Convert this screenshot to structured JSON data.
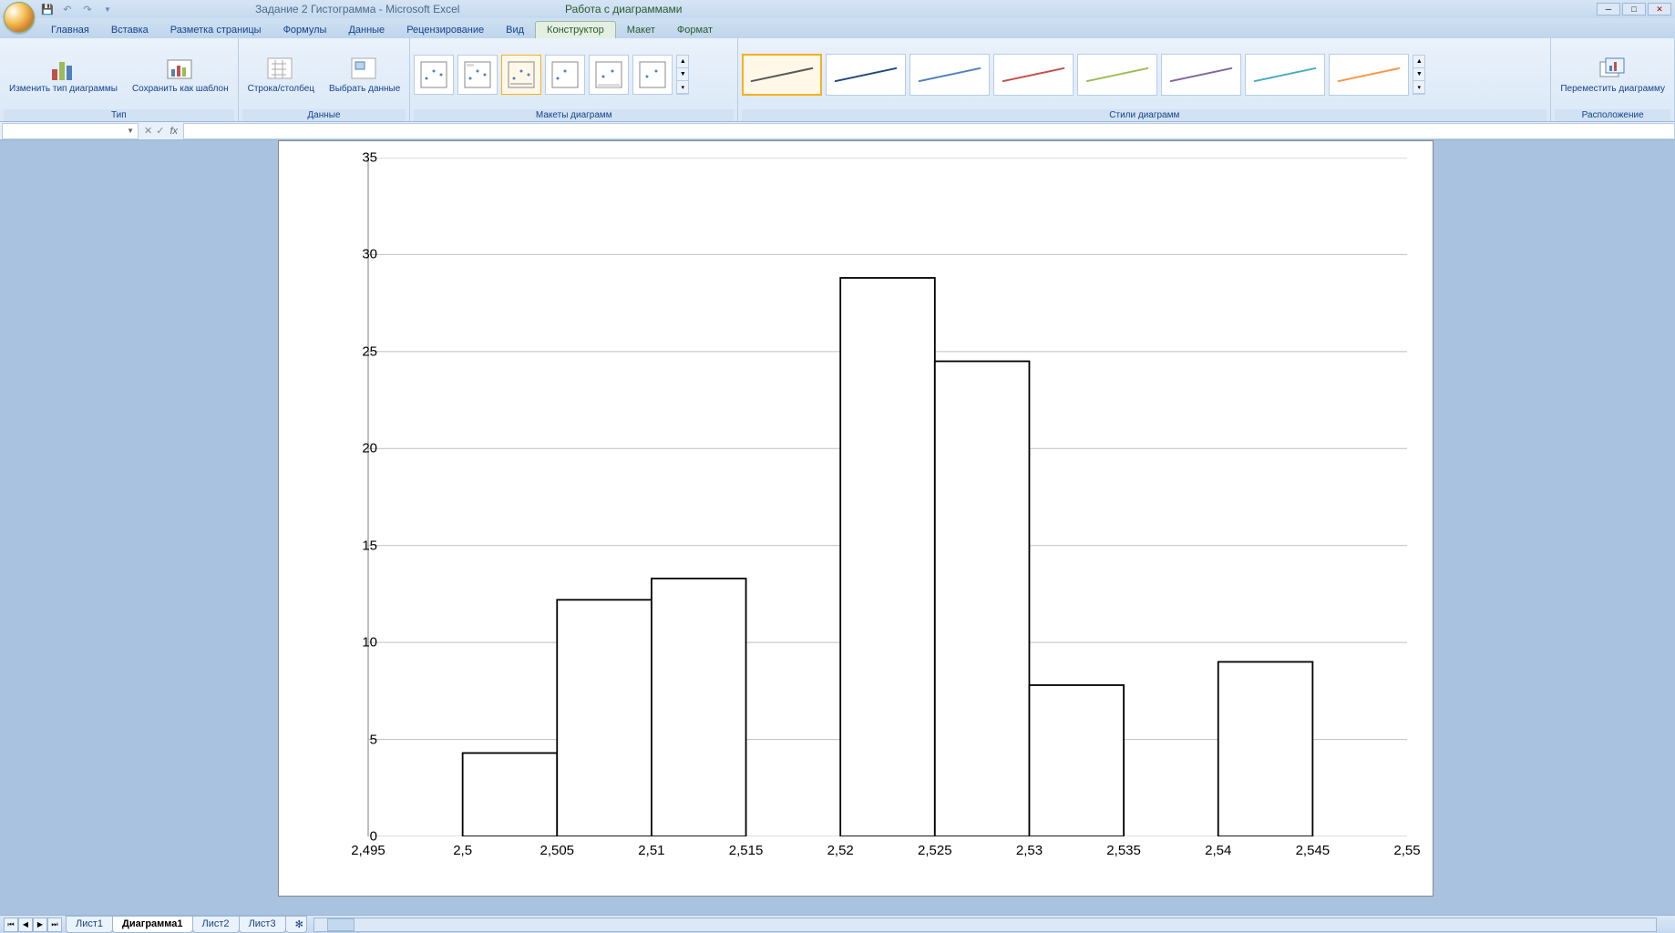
{
  "title": "Задание 2 Гистограмма - Microsoft Excel",
  "context_title": "Работа с диаграммами",
  "tabs": {
    "home": "Главная",
    "insert": "Вставка",
    "layout": "Разметка страницы",
    "formulas": "Формулы",
    "data": "Данные",
    "review": "Рецензирование",
    "view": "Вид",
    "design": "Конструктор",
    "chartlayout": "Макет",
    "format": "Формат"
  },
  "ribbon": {
    "type_group": "Тип",
    "change_type": "Изменить тип диаграммы",
    "save_template": "Сохранить как шаблон",
    "data_group": "Данные",
    "switch_rowcol": "Строка/столбец",
    "select_data": "Выбрать данные",
    "layouts_group": "Макеты диаграмм",
    "styles_group": "Стили диаграмм",
    "location_group": "Расположение",
    "move_chart": "Переместить диаграмму"
  },
  "style_colors": [
    "#595959",
    "#1f497d",
    "#4f81bd",
    "#c0504d",
    "#9bbb59",
    "#8064a2",
    "#4bacc6",
    "#f79646"
  ],
  "formula_bar": {
    "fx": "fx"
  },
  "sheets": {
    "s1": "Лист1",
    "s2": "Диаграмма1",
    "s3": "Лист2",
    "s4": "Лист3"
  },
  "chart_data": {
    "type": "bar",
    "title": "",
    "xlabel": "",
    "ylabel": "",
    "ylim": [
      0,
      35
    ],
    "y_ticks": [
      0,
      5,
      10,
      15,
      20,
      25,
      30,
      35
    ],
    "x_ticks": [
      "2,495",
      "2,5",
      "2,505",
      "2,51",
      "2,515",
      "2,52",
      "2,525",
      "2,53",
      "2,535",
      "2,54",
      "2,545",
      "2,55"
    ],
    "bars": [
      {
        "x_start": "2,5",
        "x_end": "2,505",
        "value": 4.3
      },
      {
        "x_start": "2,505",
        "x_end": "2,51",
        "value": 12.2
      },
      {
        "x_start": "2,51",
        "x_end": "2,515",
        "value": 13.3
      },
      {
        "x_start": "2,515",
        "x_end": "2,52",
        "value": 0
      },
      {
        "x_start": "2,52",
        "x_end": "2,525",
        "value": 28.8
      },
      {
        "x_start": "2,525",
        "x_end": "2,53",
        "value": 24.5
      },
      {
        "x_start": "2,53",
        "x_end": "2,535",
        "value": 7.8
      },
      {
        "x_start": "2,535",
        "x_end": "2,54",
        "value": 0
      },
      {
        "x_start": "2,54",
        "x_end": "2,545",
        "value": 9.0
      }
    ]
  }
}
